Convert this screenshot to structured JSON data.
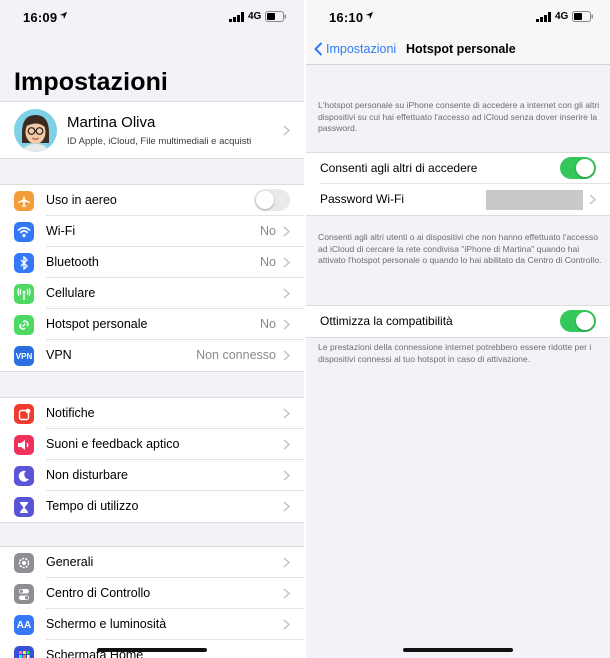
{
  "left": {
    "status": {
      "time": "16:09",
      "network": "4G"
    },
    "title": "Impostazioni",
    "profile": {
      "name": "Martina Oliva",
      "subtitle": "ID Apple, iCloud, File multimediali e acquisti"
    },
    "group1": [
      {
        "label": "Uso in aereo",
        "icon": "airplane-icon",
        "color": "#f29d38",
        "toggle": "off"
      },
      {
        "label": "Wi-Fi",
        "icon": "wifi-icon",
        "color": "#3478f6",
        "value": "No"
      },
      {
        "label": "Bluetooth",
        "icon": "bluetooth-icon",
        "color": "#3478f6",
        "value": "No"
      },
      {
        "label": "Cellulare",
        "icon": "antenna-icon",
        "color": "#4cd964",
        "value": ""
      },
      {
        "label": "Hotspot personale",
        "icon": "hotspot-icon",
        "color": "#4cd964",
        "value": "No"
      },
      {
        "label": "VPN",
        "icon": "vpn-icon",
        "color": "#2a6fe0",
        "value": "Non connesso"
      }
    ],
    "group2": [
      {
        "label": "Notifiche",
        "icon": "notifications-icon",
        "color": "#f03c30"
      },
      {
        "label": "Suoni e feedback aptico",
        "icon": "speaker-icon",
        "color": "#f0325a"
      },
      {
        "label": "Non disturbare",
        "icon": "moon-icon",
        "color": "#5a55d6"
      },
      {
        "label": "Tempo di utilizzo",
        "icon": "hourglass-icon",
        "color": "#5a55d6"
      }
    ],
    "group3": [
      {
        "label": "Generali",
        "icon": "gear-icon",
        "color": "#8e8e93"
      },
      {
        "label": "Centro di Controllo",
        "icon": "switches-icon",
        "color": "#8e8e93"
      },
      {
        "label": "Schermo e luminosità",
        "icon": "text-size-icon",
        "color": "#3478f6"
      },
      {
        "label": "Schermata Home",
        "icon": "home-grid-icon",
        "color": "#3a4fd8"
      }
    ]
  },
  "right": {
    "status": {
      "time": "16:10",
      "network": "4G"
    },
    "nav": {
      "back_label": "Impostazioni",
      "title": "Hotspot personale"
    },
    "intro": "L'hotspot personale su iPhone consente di accedere a internet con gli altri dispositivi su cui hai effettuato l'accesso ad iCloud senza dover inserire la password.",
    "allow_label": "Consenti agli altri di accedere",
    "allow_toggle": "on",
    "password_label": "Password Wi-Fi",
    "note2": "Consenti agli altri utenti o ai dispositivi che non hanno effettuato l'accesso ad iCloud di cercare la rete condivisa \"iPhone di Martina\" quando hai attivato l'hotspot personale o quando lo hai abilitato da Centro di Controllo.",
    "compat_label": "Ottimizza la compatibilità",
    "compat_toggle": "on",
    "note3": "Le prestazioni della connessione internet potrebbero essere ridotte per i dispositivi connessi al tuo hotspot in caso di attivazione."
  },
  "colors": {
    "accent": "#2f7cf6",
    "toggle_on": "#34c759"
  }
}
